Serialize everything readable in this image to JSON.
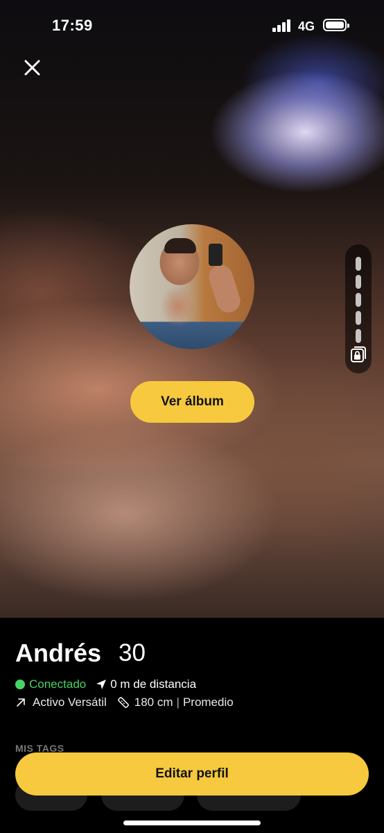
{
  "status_bar": {
    "time": "17:59",
    "network": "4G",
    "battery_level": 1.0
  },
  "icons": {
    "close": "close-icon",
    "location": "location-arrow-icon",
    "position": "arrow-up-right-icon",
    "height": "ruler-icon",
    "album_lock": "locked-album-icon"
  },
  "header": {
    "album_button_label": "Ver álbum"
  },
  "album_strip": {
    "photo_count": 5
  },
  "profile": {
    "name": "Andrés",
    "age": "30",
    "online_status": "Conectado",
    "distance": "0 m de distancia",
    "role": "Activo Versátil",
    "height": "180 cm",
    "body_type": "Promedio",
    "separator": "|",
    "tags_section_label": "MIS TAGS"
  },
  "actions": {
    "edit_profile_label": "Editar perfil"
  },
  "colors": {
    "accent": "#f6c93f",
    "online": "#46d365",
    "background": "#000000"
  }
}
